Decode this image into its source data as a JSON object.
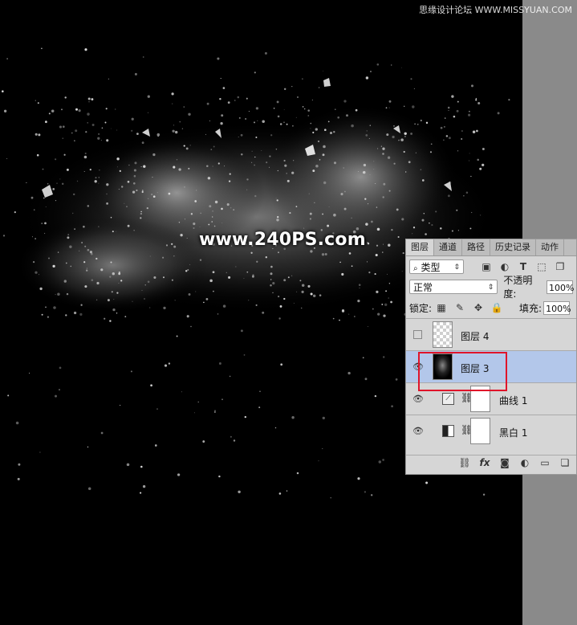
{
  "watermark_top": "思缘设计论坛 WWW.MISSYUAN.COM",
  "watermark_center": "www.240PS.com",
  "panel": {
    "tabs": [
      "图层",
      "通道",
      "路径",
      "历史记录",
      "动作"
    ],
    "filter_label": "类型",
    "blend_mode": "正常",
    "opacity_label": "不透明度:",
    "opacity_value": "100%",
    "lock_label": "锁定:",
    "fill_label": "填充:",
    "fill_value": "100%",
    "layers": [
      {
        "name": "图层 4",
        "visible": false,
        "selected": false
      },
      {
        "name": "图层 3",
        "visible": true,
        "selected": true
      },
      {
        "name": "曲线 1",
        "visible": true,
        "selected": false
      },
      {
        "name": "黑白 1",
        "visible": true,
        "selected": false
      }
    ]
  },
  "colors": {
    "highlight": "#e0142a",
    "selection": "#b3c7ea"
  }
}
